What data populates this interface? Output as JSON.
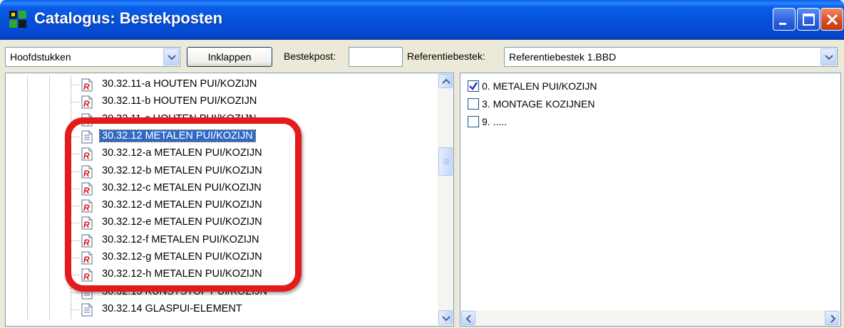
{
  "window": {
    "title": "Catalogus: Bestekposten",
    "colors": {
      "titlebar": "#0551db",
      "close": "#d84a20",
      "selection": "#316ac5",
      "highlight": "#e31b1b"
    }
  },
  "toolbar": {
    "view_select": "Hoofdstukken",
    "collapse_label": "Inklappen",
    "bestekpost_label": "Bestekpost:",
    "bestekpost_value": "",
    "referentie_label": "Referentiebestek:",
    "referentie_select": "Referentiebestek 1.BBD"
  },
  "tree": {
    "items": [
      {
        "label": "30.32.11-a HOUTEN PUI/KOZIJN",
        "icon": "red-r-document-icon"
      },
      {
        "label": "30.32.11-b HOUTEN PUI/KOZIJN",
        "icon": "red-r-document-icon"
      },
      {
        "label": "30.32.11-c HOUTEN PUI/KOZIJN",
        "icon": "red-r-document-icon"
      },
      {
        "label": "30.32.12  METALEN PUI/KOZIJN",
        "icon": "document-icon",
        "selected": true
      },
      {
        "label": "30.32.12-a METALEN PUI/KOZIJN",
        "icon": "red-r-document-icon"
      },
      {
        "label": "30.32.12-b METALEN PUI/KOZIJN",
        "icon": "red-r-document-icon"
      },
      {
        "label": "30.32.12-c METALEN PUI/KOZIJN",
        "icon": "red-r-document-icon"
      },
      {
        "label": "30.32.12-d METALEN PUI/KOZIJN",
        "icon": "red-r-document-icon"
      },
      {
        "label": "30.32.12-e METALEN PUI/KOZIJN",
        "icon": "red-r-document-icon"
      },
      {
        "label": "30.32.12-f METALEN PUI/KOZIJN",
        "icon": "red-r-document-icon"
      },
      {
        "label": "30.32.12-g METALEN PUI/KOZIJN",
        "icon": "red-r-document-icon"
      },
      {
        "label": "30.32.12-h METALEN PUI/KOZIJN",
        "icon": "red-r-document-icon"
      },
      {
        "label": "30.32.13  KUNSTSTOF PUI/KOZIJN",
        "icon": "document-icon"
      },
      {
        "label": "30.32.14  GLASPUI-ELEMENT",
        "icon": "document-icon"
      }
    ]
  },
  "checklist": {
    "items": [
      {
        "label": "0. METALEN PUI/KOZIJN",
        "checked": true
      },
      {
        "label": "3. MONTAGE KOZIJNEN",
        "checked": false
      },
      {
        "label": "9. .....",
        "checked": false
      }
    ]
  }
}
